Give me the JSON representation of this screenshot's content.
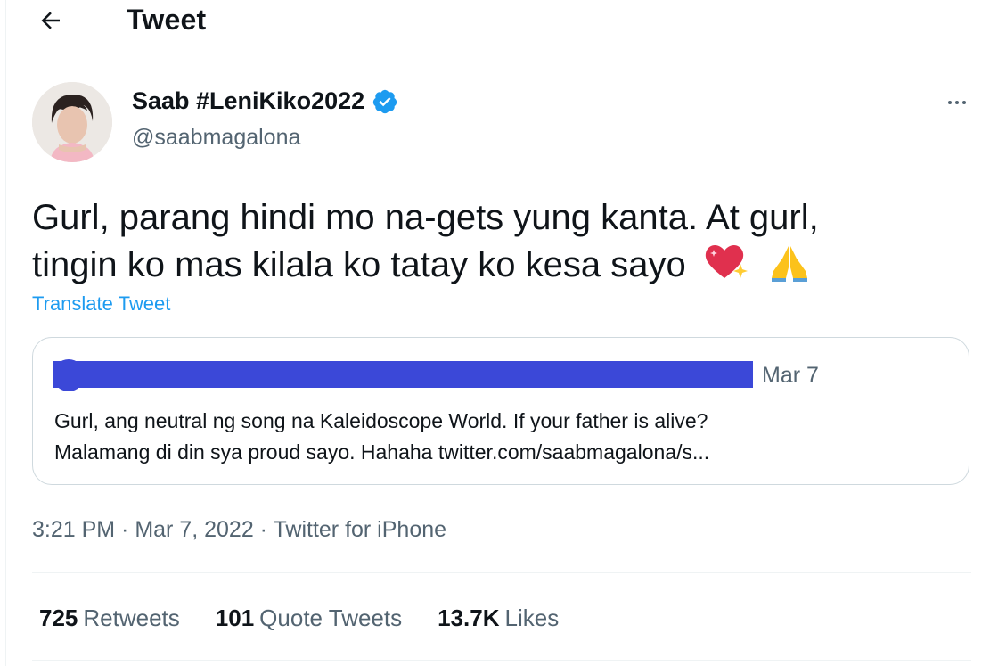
{
  "header": {
    "title": "Tweet",
    "back_icon": "arrow-left-icon"
  },
  "tweet": {
    "author_name": "Saab #LeniKiko2022",
    "verified": true,
    "handle": "@saabmagalona",
    "text_line1": "Gurl, parang hindi mo na-gets yung kanta. At gurl,",
    "text_line2": "tingin ko mas kilala ko tatay ko kesa sayo",
    "emojis": [
      "sparkling-heart-icon",
      "folded-hands-icon"
    ],
    "translate_label": "Translate Tweet",
    "timestamp": "3:21 PM · Mar 7, 2022 · ",
    "client": "Twitter for iPhone"
  },
  "quote": {
    "date": "Mar 7",
    "text_line1": "Gurl, ang neutral ng song na Kaleidoscope World. If your father is alive?",
    "text_line2": "Malamang di din sya proud sayo. Hahaha twitter.com/saabmagalona/s..."
  },
  "stats": {
    "retweets_count": "725",
    "retweets_label": "Retweets",
    "quotes_count": "101",
    "quotes_label": "Quote Tweets",
    "likes_count": "13.7K",
    "likes_label": "Likes"
  },
  "colors": {
    "accent": "#1d9bf0",
    "redaction": "#3b48d8",
    "secondary_text": "#536471"
  }
}
